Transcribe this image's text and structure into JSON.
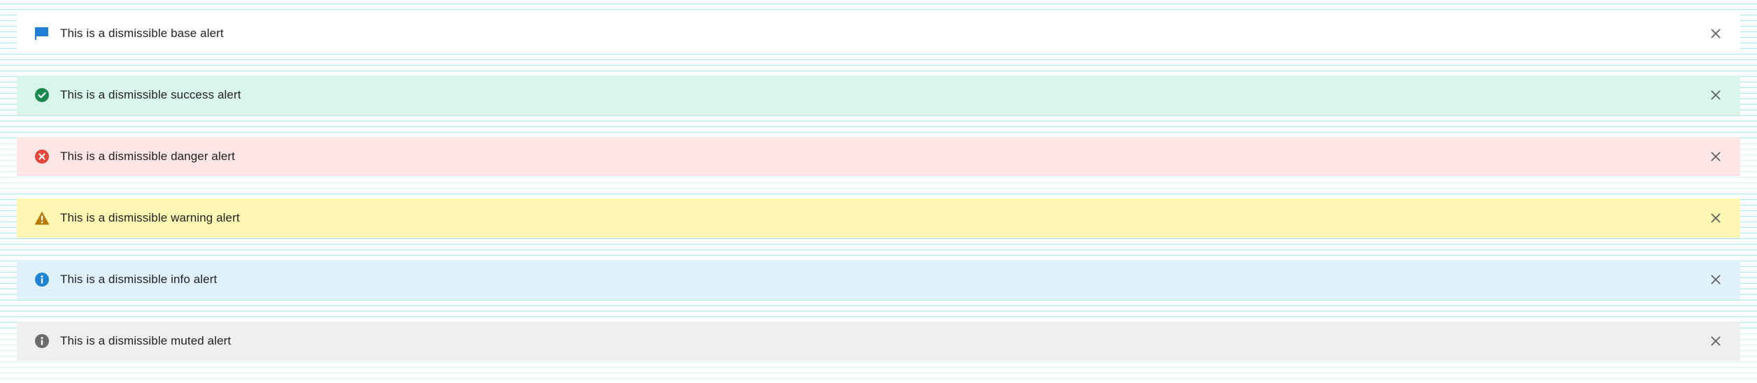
{
  "alerts": [
    {
      "variant": "base",
      "message": "This is a dismissible base alert",
      "icon": "flag-icon",
      "background": "#ffffff",
      "icon_color": "#1f7fd6"
    },
    {
      "variant": "success",
      "message": "This is a dismissible success alert",
      "icon": "check-circle-icon",
      "background": "#d8f7ea",
      "icon_color": "#1c8a4e"
    },
    {
      "variant": "danger",
      "message": "This is a dismissible danger alert",
      "icon": "x-circle-icon",
      "background": "#ffe5e5",
      "icon_color": "#e0483b"
    },
    {
      "variant": "warning",
      "message": "This is a dismissible warning alert",
      "icon": "warning-triangle-icon",
      "background": "#fff7b3",
      "icon_color": "#b97a06"
    },
    {
      "variant": "info",
      "message": "This is a dismissible info alert",
      "icon": "info-circle-icon",
      "background": "#dff1fd",
      "icon_color": "#1f84d2"
    },
    {
      "variant": "muted",
      "message": "This is a dismissible muted alert",
      "icon": "info-circle-icon",
      "background": "#f0eeee",
      "icon_color": "#6b6b6b"
    }
  ],
  "close_icon": "close-icon",
  "close_color": "#5a5a5a"
}
